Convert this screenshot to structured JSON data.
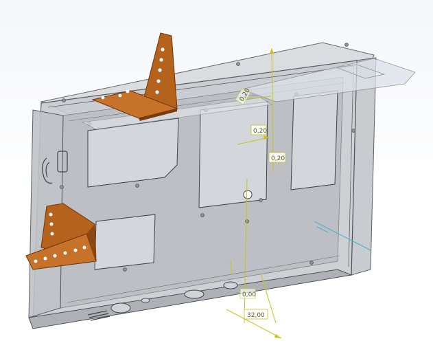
{
  "scene": {
    "description_free": true,
    "colors": {
      "background_top": "#f4f6f9",
      "enclosure_fill": "#c9ccd0",
      "enclosure_edge": "#4b4f55",
      "bracket": "#b5621d",
      "bracket_dark": "#7a3e0e",
      "dimension": "#c7c21a",
      "sketch_blue": "#4fb3c8"
    },
    "icons": [
      "mounting-bracket-icon",
      "dimension-arrow-icon"
    ]
  },
  "dimensions": {
    "d1": "0,20",
    "d2": "0,20",
    "d3": "0,20",
    "d4": "32,00",
    "d5": "0,00"
  }
}
